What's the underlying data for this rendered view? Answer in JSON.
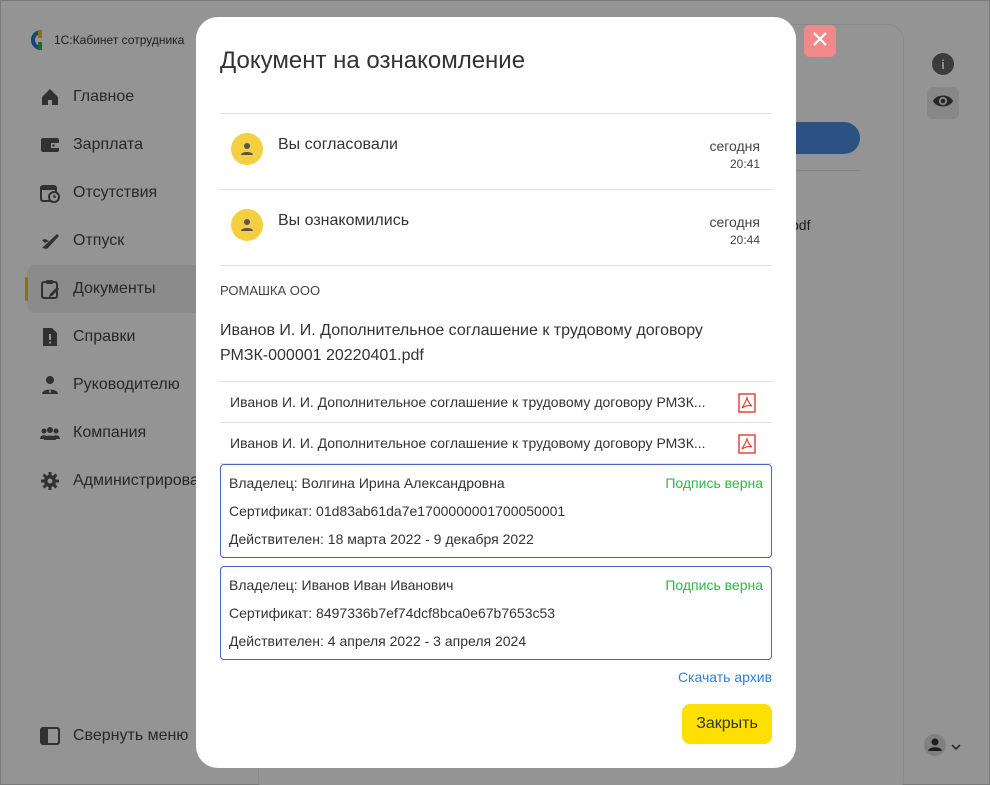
{
  "app": {
    "name": "1С:Кабинет сотрудника",
    "sidebar": {
      "items": [
        {
          "label": "Главное",
          "icon": "home-icon"
        },
        {
          "label": "Зарплата",
          "icon": "wallet-icon"
        },
        {
          "label": "Отсутствия",
          "icon": "calendar-clock-icon"
        },
        {
          "label": "Отпуск",
          "icon": "plane-icon"
        },
        {
          "label": "Документы",
          "icon": "clipboard-icon",
          "active": true
        },
        {
          "label": "Справки",
          "icon": "document-alert-icon"
        },
        {
          "label": "Руководителю",
          "icon": "manager-icon"
        },
        {
          "label": "Компания",
          "icon": "group-icon"
        },
        {
          "label": "Администрирова",
          "icon": "gear-icon"
        }
      ],
      "collapse_label": "Свернуть меню"
    },
    "main": {
      "pdf_fragment": "pdf"
    }
  },
  "modal": {
    "title": "Документ на ознакомление",
    "history": [
      {
        "text": "Вы согласовали",
        "date": "сегодня",
        "time": "20:41"
      },
      {
        "text": "Вы ознакомились",
        "date": "сегодня",
        "time": "20:44"
      }
    ],
    "organization": "РОМАШКА ООО",
    "document_title": "Иванов И. И. Дополнительное соглашение к трудовому договору РМЗК-000001 20220401.pdf",
    "files": [
      {
        "name": "Иванов И. И. Дополнительное соглашение к трудовому договору РМЗК-000001 20220401.pdf",
        "display": "Иванов И. И. Дополнительное соглашение к трудовому договору РМЗК..."
      },
      {
        "name": "Иванов И. И. Дополнительное соглашение к трудовому договору РМЗК-000001 20220401.pdf",
        "display": "Иванов И. И. Дополнительное соглашение к трудовому договору РМЗК..."
      }
    ],
    "signatures": [
      {
        "owner": "Владелец: Волгина Ирина Александровна",
        "certificate": "Сертификат: 01d83ab61da7e1700000001700050001",
        "valid": "Действителен: 18 марта 2022 - 9 декабря 2022",
        "status": "Подпись верна"
      },
      {
        "owner": "Владелец: Иванов Иван Иванович",
        "certificate": "Сертификат: 8497336b7ef74dcf8bca0e67b7653c53",
        "valid": "Действителен: 4 апреля 2022 - 3 апреля 2024",
        "status": "Подпись верна"
      }
    ],
    "download_label": "Скачать архив",
    "close_label": "Закрыть"
  },
  "colors": {
    "accent_yellow": "#ffdf00",
    "avatar_yellow": "#f5cf40",
    "signature_border": "#4a62c8",
    "status_green": "#2fb64a",
    "link_blue": "#2f7fd8",
    "close_red": "#f08a8a"
  }
}
